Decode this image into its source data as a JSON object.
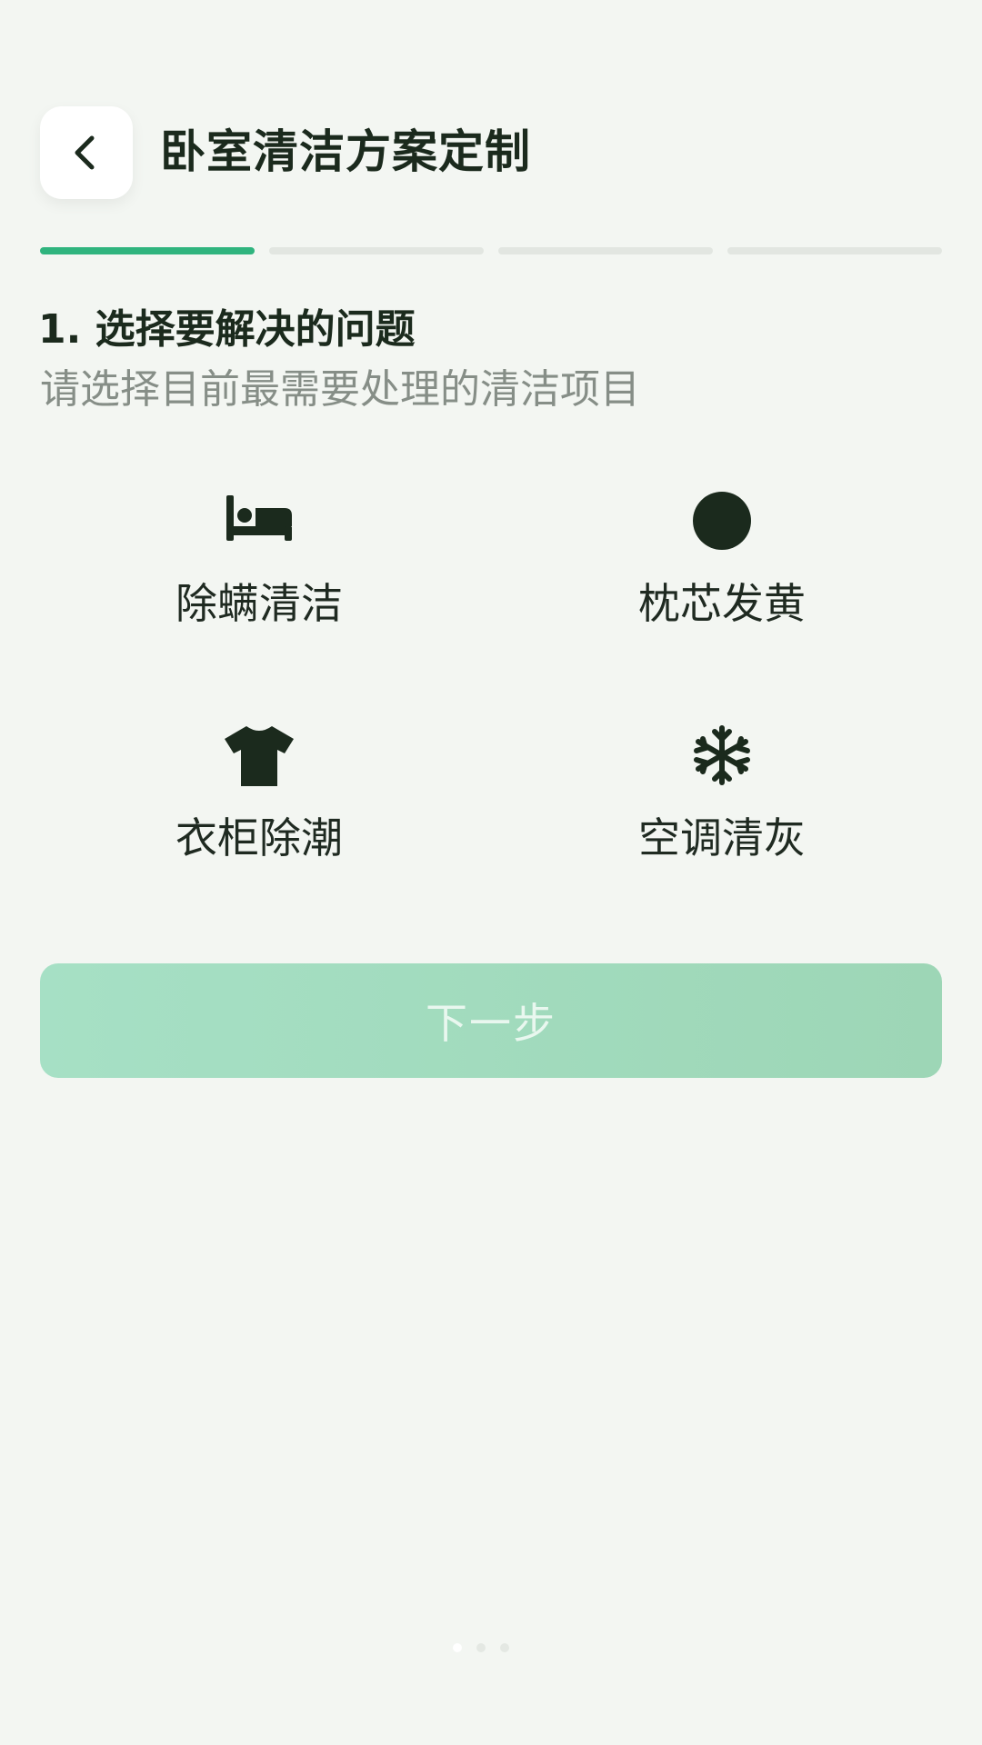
{
  "header": {
    "back_icon": "chevron-left-icon",
    "title": "卧室清洁方案定制"
  },
  "progress": {
    "total_steps": 4,
    "current_step": 1
  },
  "step": {
    "title": "1. 选择要解决的问题",
    "subtitle": "请选择目前最需要处理的清洁项目"
  },
  "options": [
    {
      "label": "除螨清洁",
      "icon": "bed-icon"
    },
    {
      "label": "枕芯发黄",
      "icon": "circle-icon"
    },
    {
      "label": "衣柜除潮",
      "icon": "tshirt-icon"
    },
    {
      "label": "空调清灰",
      "icon": "snowflake-icon"
    }
  ],
  "next_button": {
    "label": "下一步"
  },
  "colors": {
    "accent": "#2fb47e",
    "background": "#f3f6f2",
    "button_disabled": "#a3dcc0",
    "text_primary": "#1b2a1d",
    "text_secondary": "#868e87"
  }
}
